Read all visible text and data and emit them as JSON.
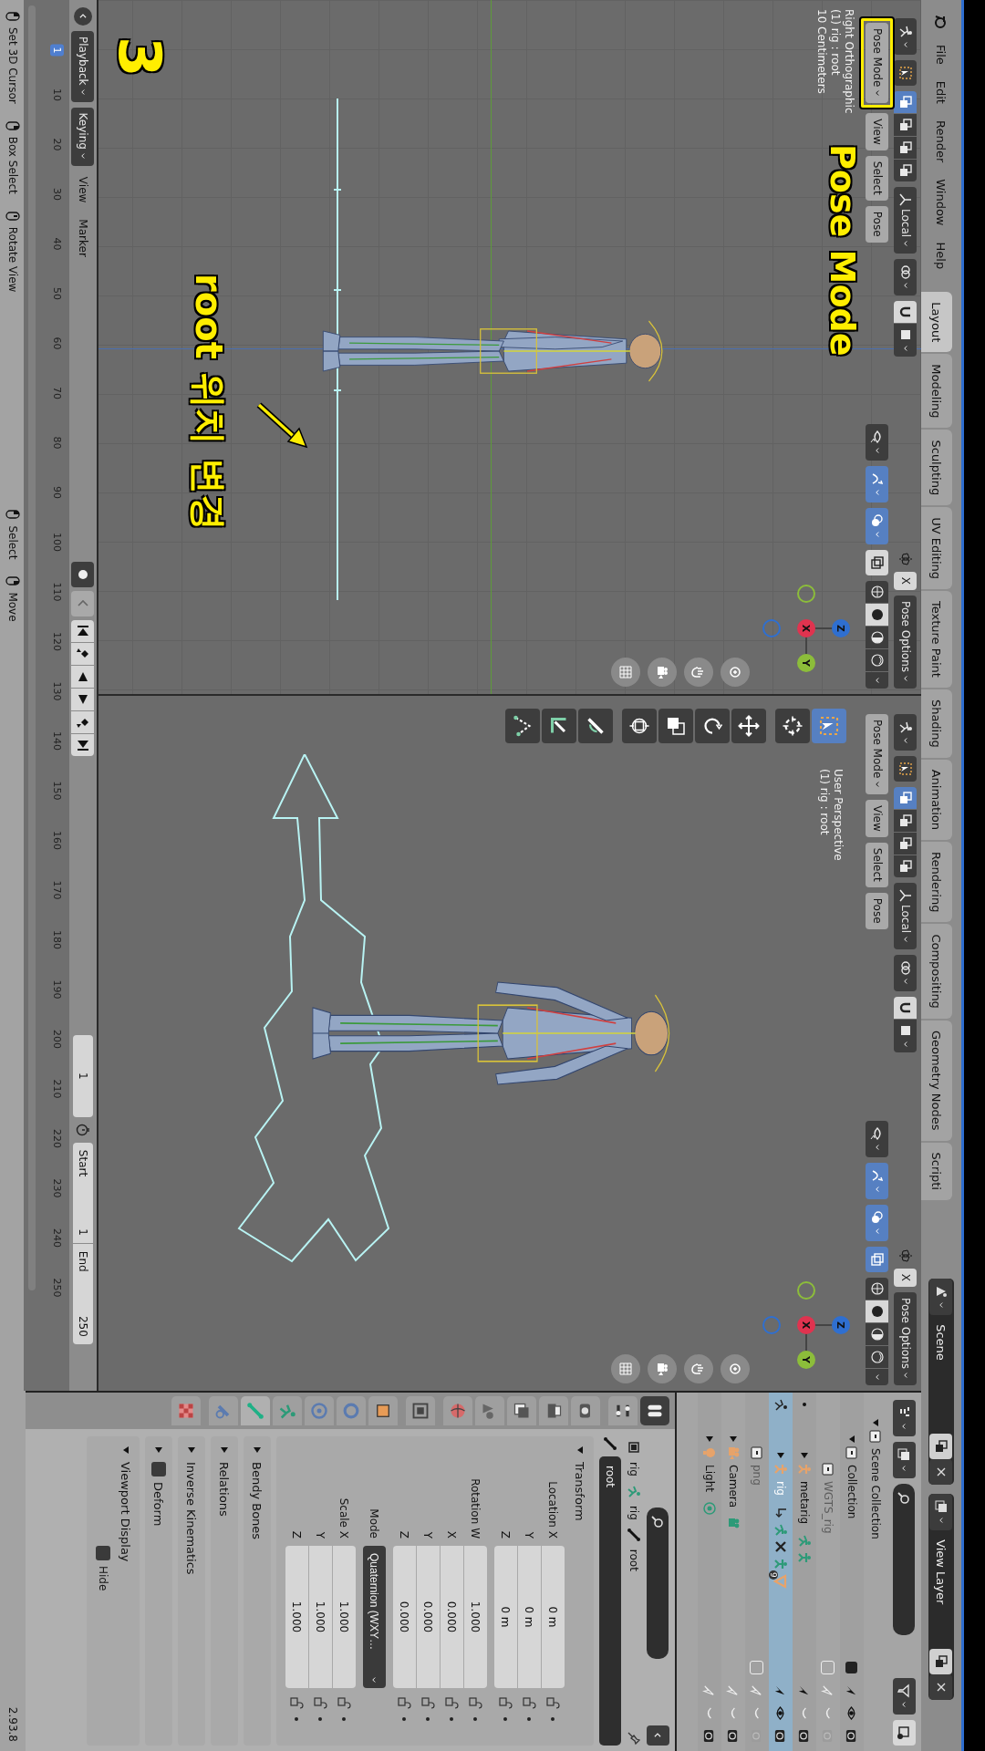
{
  "menu_bar": {
    "menus": [
      "File",
      "Edit",
      "Render",
      "Window",
      "Help"
    ]
  },
  "workspaces": [
    {
      "label": "Layout",
      "selected": true
    },
    {
      "label": "Modeling",
      "selected": false
    },
    {
      "label": "Sculpting",
      "selected": false
    },
    {
      "label": "UV Editing",
      "selected": false
    },
    {
      "label": "Texture Paint",
      "selected": false
    },
    {
      "label": "Shading",
      "selected": false
    },
    {
      "label": "Animation",
      "selected": false
    },
    {
      "label": "Rendering",
      "selected": false
    },
    {
      "label": "Compositing",
      "selected": false
    },
    {
      "label": "Geometry Nodes",
      "selected": false
    },
    {
      "label": "Scripti",
      "selected": false
    }
  ],
  "scene": {
    "name": "Scene"
  },
  "view_layer": {
    "name": "View Layer"
  },
  "viewports": [
    {
      "kind": "orthographic",
      "mode": "Pose Mode",
      "mode_highlighted": true,
      "menus": [
        "View",
        "Select",
        "Pose"
      ],
      "orientation": "Local",
      "mirror": "X",
      "options": "Pose Options",
      "select_modes": [
        {
          "selected": true
        },
        {
          "selected": false
        },
        {
          "selected": false
        },
        {
          "selected": false
        }
      ],
      "toggles": [
        {
          "kind": "visibility",
          "on": false
        },
        {
          "kind": "gizmo",
          "on": true
        },
        {
          "kind": "overlay",
          "on": true
        },
        {
          "kind": "xray",
          "on": false
        }
      ],
      "shading": [
        {
          "kind": "wireframe",
          "selected": false
        },
        {
          "kind": "solid",
          "selected": true
        },
        {
          "kind": "material",
          "selected": false
        },
        {
          "kind": "rendered",
          "selected": false
        }
      ],
      "info": [
        "Right Orthographic",
        "(1) rig : root",
        "10 Centimeters"
      ],
      "gizmo": [
        "Z",
        "X",
        "Y"
      ]
    },
    {
      "kind": "perspective",
      "mode": "Pose Mode",
      "mode_highlighted": false,
      "menus": [
        "View",
        "Select",
        "Pose"
      ],
      "orientation": "Local",
      "mirror": "X",
      "options": "Pose Options",
      "select_modes": [
        {
          "selected": true
        },
        {
          "selected": false
        },
        {
          "selected": false
        },
        {
          "selected": false
        }
      ],
      "toggles": [
        {
          "kind": "visibility",
          "on": false
        },
        {
          "kind": "gizmo",
          "on": true
        },
        {
          "kind": "overlay",
          "on": true
        },
        {
          "kind": "xray",
          "on": true
        }
      ],
      "shading": [
        {
          "kind": "wireframe",
          "selected": false
        },
        {
          "kind": "solid",
          "selected": true
        },
        {
          "kind": "material",
          "selected": false
        },
        {
          "kind": "rendered",
          "selected": false
        }
      ],
      "info": [
        "User Perspective",
        "(1) rig : root"
      ],
      "gizmo": [
        "Z",
        "X",
        "Y"
      ],
      "tools": [
        {
          "kind": "select_box",
          "selected": true
        },
        {
          "kind": "cursor",
          "selected": false
        },
        {
          "kind": "move",
          "selected": false
        },
        {
          "kind": "rotate",
          "selected": false
        },
        {
          "kind": "scale",
          "selected": false
        },
        {
          "kind": "transform",
          "selected": false
        },
        {
          "kind": "bone_roll",
          "selected": false
        },
        {
          "kind": "bone_size",
          "selected": false
        },
        {
          "kind": "measure",
          "selected": false
        }
      ]
    }
  ],
  "annotations": {
    "title": "Pose Mode",
    "note": "root 위치 변경",
    "step": "3"
  },
  "timeline": {
    "menus": [
      "Playback",
      "Keying",
      "View",
      "Marker"
    ],
    "current_frame": "1",
    "start_label": "Start",
    "start": "1",
    "end_label": "End",
    "end": "250",
    "ticks": [
      {
        "label": "1",
        "selected": true
      },
      {
        "label": "10",
        "selected": false
      },
      {
        "label": "20",
        "selected": false
      },
      {
        "label": "30",
        "selected": false
      },
      {
        "label": "40",
        "selected": false
      },
      {
        "label": "50",
        "selected": false
      },
      {
        "label": "60",
        "selected": false
      },
      {
        "label": "70",
        "selected": false
      },
      {
        "label": "80",
        "selected": false
      },
      {
        "label": "90",
        "selected": false
      },
      {
        "label": "100",
        "selected": false
      },
      {
        "label": "110",
        "selected": false
      },
      {
        "label": "120",
        "selected": false
      },
      {
        "label": "130",
        "selected": false
      },
      {
        "label": "140",
        "selected": false
      },
      {
        "label": "150",
        "selected": false
      },
      {
        "label": "160",
        "selected": false
      },
      {
        "label": "170",
        "selected": false
      },
      {
        "label": "180",
        "selected": false
      },
      {
        "label": "190",
        "selected": false
      },
      {
        "label": "200",
        "selected": false
      },
      {
        "label": "210",
        "selected": false
      },
      {
        "label": "220",
        "selected": false
      },
      {
        "label": "230",
        "selected": false
      },
      {
        "label": "240",
        "selected": false
      },
      {
        "label": "250",
        "selected": false
      }
    ]
  },
  "outliner": {
    "tree": [
      {
        "label": "Scene Collection",
        "kind": "scene_collection",
        "expanded": true,
        "children": [
          {
            "label": "Collection",
            "kind": "collection",
            "expanded": true,
            "checked": true,
            "selectable": true,
            "visible": true,
            "renderable": true,
            "children": [
              {
                "label": "WGTS_rig",
                "kind": "collection",
                "checked": false,
                "selectable": false,
                "visible": false,
                "renderable": false
              },
              {
                "label": "metarig",
                "kind": "armature",
                "expanded": false,
                "pose_mode": false,
                "selectable": true,
                "visible": false,
                "renderable": true,
                "extras": [
                  {
                    "kind": "pose"
                  },
                  {
                    "kind": "armature_data"
                  }
                ]
              },
              {
                "label": "rig",
                "kind": "armature",
                "expanded": false,
                "selected": true,
                "pose_mode": true,
                "selectable": true,
                "visible": true,
                "renderable": true,
                "extras": [
                  {
                    "kind": "parent"
                  },
                  {
                    "kind": "pose"
                  },
                  {
                    "kind": "bones"
                  },
                  {
                    "kind": "armature_data"
                  },
                  {
                    "kind": "mesh",
                    "count": "9"
                  }
                ]
              }
            ]
          },
          {
            "label": "png",
            "kind": "collection",
            "checked": false,
            "selectable": false,
            "visible": false,
            "renderable": false
          },
          {
            "label": "Camera",
            "kind": "camera",
            "expanded": false,
            "selectable": false,
            "visible": false,
            "renderable": true,
            "extras": [
              {
                "kind": "camera_data"
              }
            ]
          },
          {
            "label": "Light",
            "kind": "light",
            "expanded": false,
            "selectable": false,
            "visible": false,
            "renderable": true,
            "extras": [
              {
                "kind": "light_data"
              }
            ]
          }
        ]
      }
    ]
  },
  "properties": {
    "tabs": [
      {
        "kind": "tool",
        "selected": false
      },
      {
        "kind": "render",
        "selected": false
      },
      {
        "kind": "output",
        "selected": false
      },
      {
        "kind": "view_layer",
        "selected": false
      },
      {
        "kind": "scene",
        "selected": false
      },
      {
        "kind": "world",
        "selected": false
      },
      {
        "kind": "collection",
        "selected": false
      },
      {
        "kind": "object",
        "selected": false
      },
      {
        "kind": "constraints",
        "selected": false
      },
      {
        "kind": "physics",
        "selected": false
      },
      {
        "kind": "data",
        "selected": false
      },
      {
        "kind": "bone",
        "selected": true
      },
      {
        "kind": "bone_constraint",
        "selected": false
      },
      {
        "kind": "texture",
        "selected": false
      }
    ],
    "breadcrumb": [
      "rig",
      "rig",
      "root"
    ],
    "bone_name": "root",
    "panels": [
      {
        "title": "Transform",
        "kind": "transform",
        "expanded": true,
        "groups": [
          {
            "kind": "numbers",
            "rows": [
              {
                "label": "Location X",
                "value": "0 m"
              },
              {
                "label": "Y",
                "value": "0 m"
              },
              {
                "label": "Z",
                "value": "0 m"
              }
            ]
          },
          {
            "kind": "numbers",
            "rows": [
              {
                "label": "Rotation W",
                "value": "1.000"
              },
              {
                "label": "X",
                "value": "0.000"
              },
              {
                "label": "Y",
                "value": "0.000"
              },
              {
                "label": "Z",
                "value": "0.000"
              }
            ]
          },
          {
            "kind": "dropdown",
            "label": "Mode",
            "value": "Quaternion (WXY…"
          },
          {
            "kind": "numbers",
            "rows": [
              {
                "label": "Scale X",
                "value": "1.000"
              },
              {
                "label": "Y",
                "value": "1.000"
              },
              {
                "label": "Z",
                "value": "1.000"
              }
            ]
          }
        ]
      },
      {
        "title": "Bendy Bones",
        "kind": "plain",
        "expanded": false
      },
      {
        "title": "Relations",
        "kind": "plain",
        "expanded": false
      },
      {
        "title": "Inverse Kinematics",
        "kind": "plain",
        "expanded": false
      },
      {
        "title": "Deform",
        "kind": "checkbox",
        "expanded": false,
        "checked": false
      },
      {
        "title": "Viewport Display",
        "kind": "options",
        "expanded": true,
        "options": [
          {
            "label": "Hide",
            "checked": false
          }
        ]
      }
    ]
  },
  "status_bar": {
    "mouse_hints": [
      {
        "kind": "left",
        "label": "Set 3D Cursor"
      },
      {
        "kind": "right",
        "label": "Box Select"
      },
      {
        "kind": "middle",
        "label": "Rotate View"
      }
    ],
    "tool_hints": [
      {
        "kind": "left",
        "label": "Select"
      },
      {
        "kind": "right",
        "label": "Move"
      }
    ],
    "version": "2.93.8"
  }
}
